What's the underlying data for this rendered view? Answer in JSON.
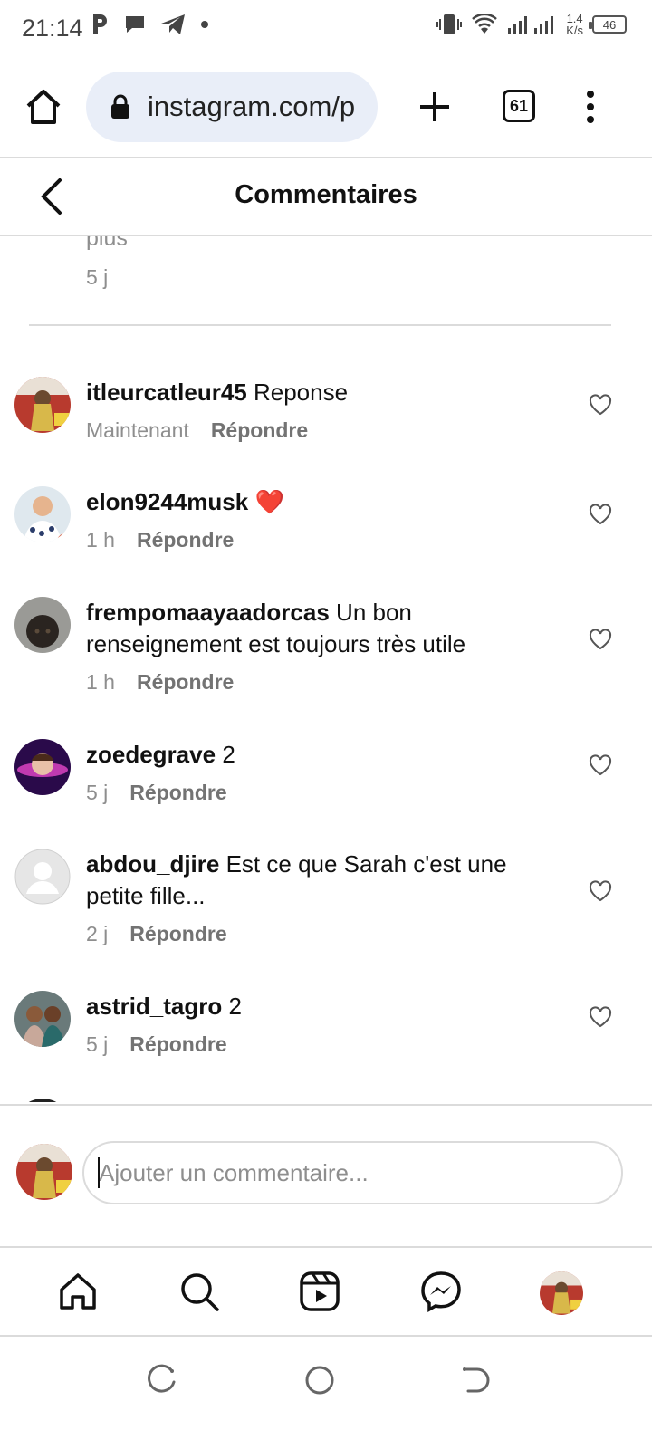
{
  "status_bar": {
    "time": "21:14",
    "speed_value": "1.4",
    "speed_unit": "K/s",
    "battery": "46"
  },
  "browser": {
    "url": "instagram.com/p",
    "tab_count": "61"
  },
  "header": {
    "title": "Commentaires"
  },
  "previous_comment": {
    "tail_text": "plus",
    "time": "5 j"
  },
  "comments": [
    {
      "username": "itleurcatleur45",
      "text": "Reponse",
      "time": "Maintenant",
      "reply": "Répondre"
    },
    {
      "username": "elon9244musk",
      "text": "❤️",
      "time": "1 h",
      "reply": "Répondre"
    },
    {
      "username": "frempomaayaadorcas",
      "text": "Un bon renseignement est toujours très utile",
      "time": "1 h",
      "reply": "Répondre"
    },
    {
      "username": "zoedegrave",
      "text": "2",
      "time": "5 j",
      "reply": "Répondre"
    },
    {
      "username": "abdou_djire",
      "text": "Est ce que Sarah c'est une petite fille...",
      "time": "2 j",
      "reply": "Répondre"
    },
    {
      "username": "astrid_tagro",
      "text": "2",
      "time": "5 j",
      "reply": "Répondre"
    }
  ],
  "composer": {
    "placeholder": "Ajouter un commentaire..."
  },
  "icons": {
    "status": [
      "parking-icon",
      "chat-bubble-icon",
      "telegram-icon",
      "dot-icon",
      "vibrate-icon",
      "wifi-icon",
      "signal-icon",
      "battery-icon"
    ],
    "browser": [
      "home-icon",
      "lock-icon",
      "plus-icon",
      "tabs-icon",
      "more-vert-icon"
    ],
    "bottom_nav": [
      "home-icon",
      "search-icon",
      "reels-icon",
      "messenger-icon",
      "profile-avatar"
    ],
    "system_nav": [
      "recents-icon",
      "home-circle-icon",
      "back-icon"
    ]
  },
  "colors": {
    "url_bar_bg": "#e9eef8",
    "secondary_text": "#8e8e8e",
    "divider": "#dbdbdb",
    "heart_emoji": "#e0245e"
  }
}
